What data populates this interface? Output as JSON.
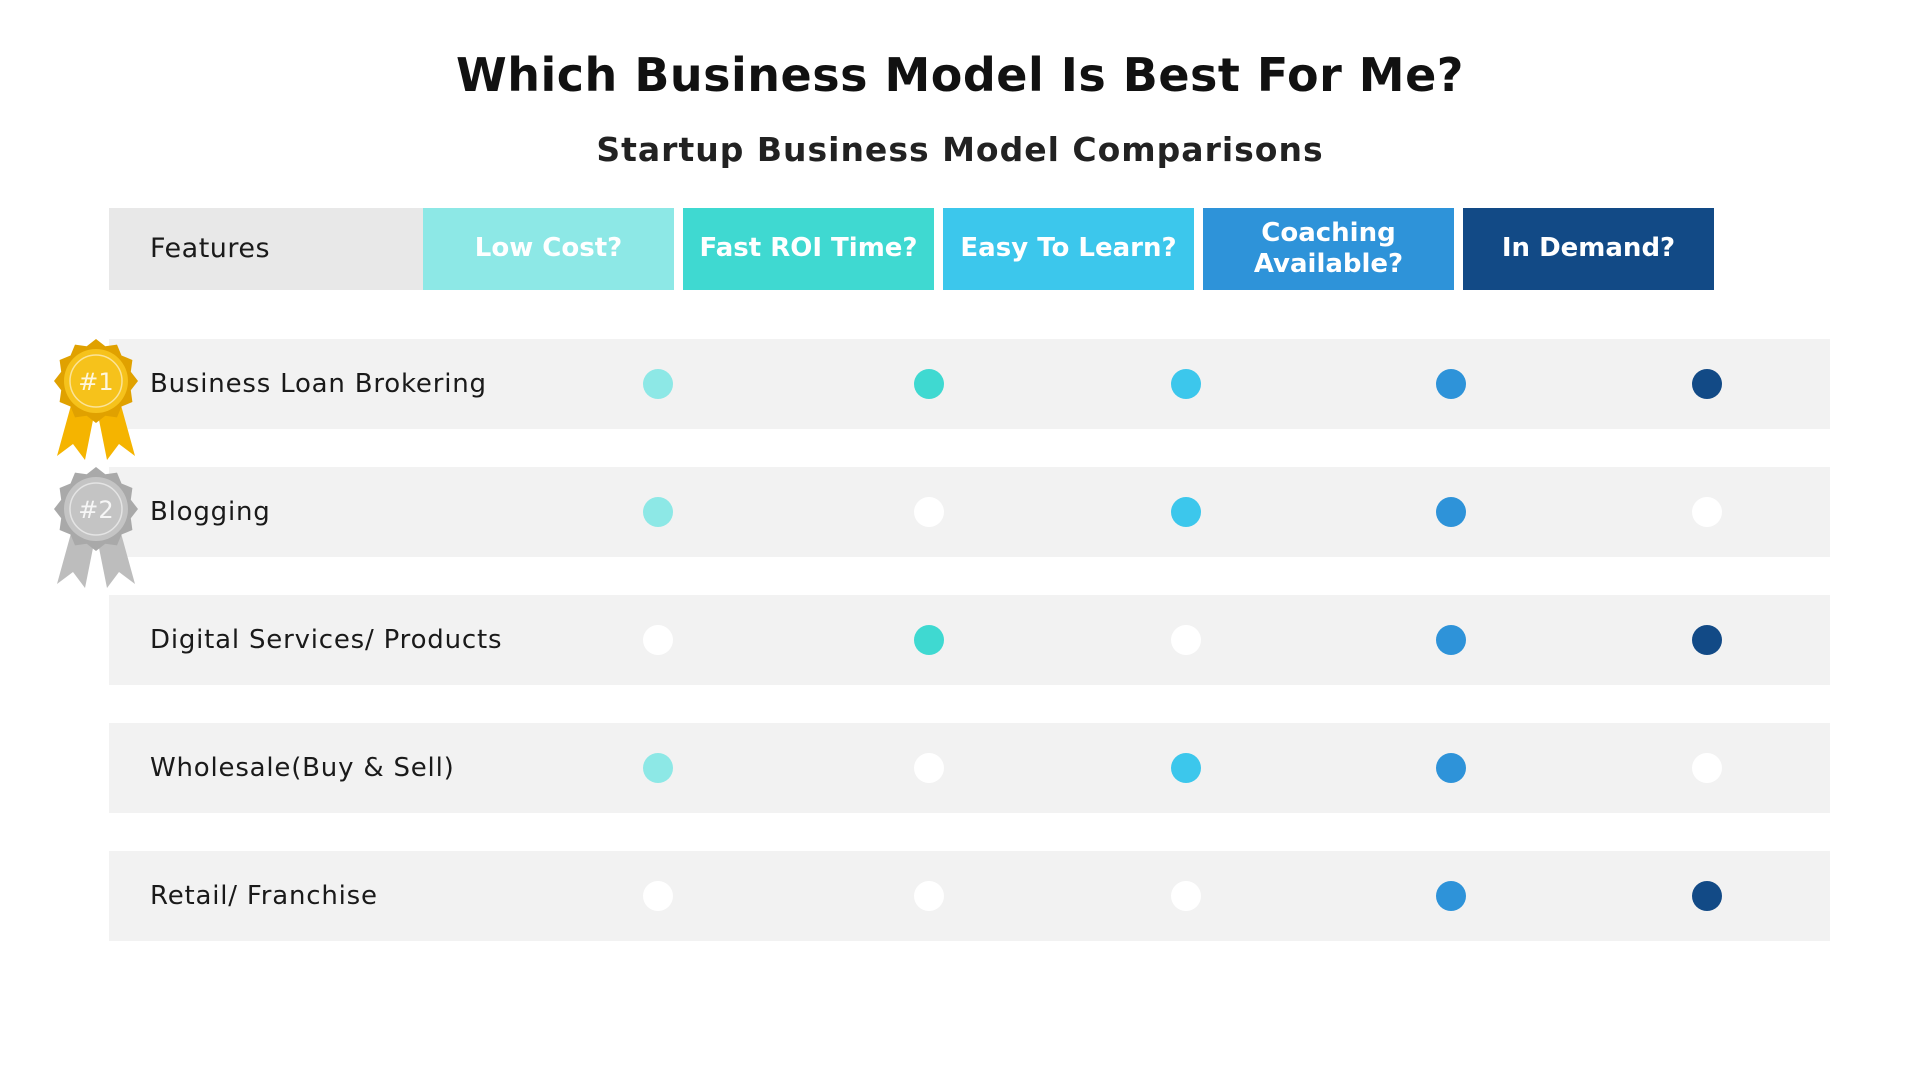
{
  "chart_data": {
    "type": "table",
    "title": "Which Business Model Is Best For Me?",
    "subtitle": "Startup Business Model Comparisons",
    "row_header": "Features",
    "columns": [
      {
        "label": "Low Cost?",
        "color": "#8de8e6"
      },
      {
        "label": "Fast ROI Time?",
        "color": "#3fd9d1"
      },
      {
        "label": "Easy To Learn?",
        "color": "#3cc7ec"
      },
      {
        "label": "Coaching Available?",
        "color": "#2e93d9"
      },
      {
        "label": "In Demand?",
        "color": "#124a86"
      }
    ],
    "rows": [
      {
        "label": "Business Loan Brokering",
        "rank": "#1",
        "values": [
          true,
          true,
          true,
          true,
          true
        ]
      },
      {
        "label": "Blogging",
        "rank": "#2",
        "values": [
          true,
          false,
          true,
          true,
          false
        ]
      },
      {
        "label": "Digital Services/ Products",
        "values": [
          false,
          true,
          false,
          true,
          true
        ]
      },
      {
        "label": "Wholesale(Buy & Sell)",
        "values": [
          true,
          false,
          true,
          true,
          false
        ]
      },
      {
        "label": "Retail/ Franchise",
        "values": [
          false,
          false,
          false,
          true,
          true
        ]
      }
    ],
    "empty_color": "#ffffff",
    "header_background": "#e8e8e8",
    "row_background": "#f2f2f2",
    "medal_colors": {
      "gold": "#f6c21b",
      "silver": "#c4c4c4"
    }
  }
}
